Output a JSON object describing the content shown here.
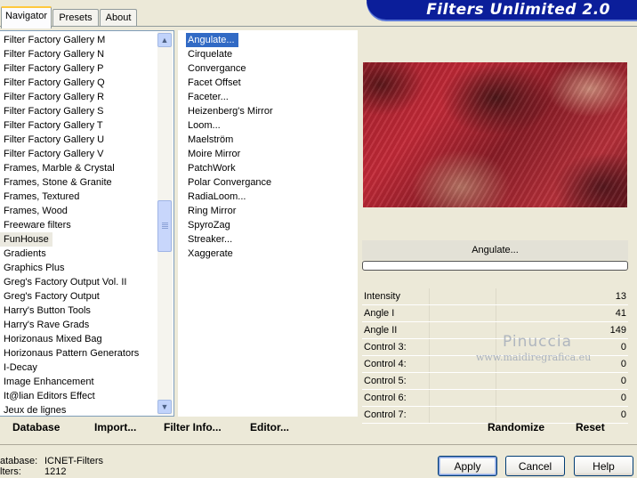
{
  "tabs": [
    "Navigator",
    "Presets",
    "About"
  ],
  "header_title": "Filters Unlimited 2.0",
  "categories": [
    "Filter Factory Gallery M",
    "Filter Factory Gallery N",
    "Filter Factory Gallery P",
    "Filter Factory Gallery Q",
    "Filter Factory Gallery R",
    "Filter Factory Gallery S",
    "Filter Factory Gallery T",
    "Filter Factory Gallery U",
    "Filter Factory Gallery V",
    "Frames, Marble & Crystal",
    "Frames, Stone & Granite",
    "Frames, Textured",
    "Frames, Wood",
    "Freeware filters",
    "FunHouse",
    "Gradients",
    "Graphics Plus",
    "Greg's Factory Output Vol. II",
    "Greg's Factory Output",
    "Harry's Button Tools",
    "Harry's Rave Grads",
    "Horizonaus Mixed Bag",
    "Horizonaus Pattern Generators",
    "I-Decay",
    "Image Enhancement",
    "It@lian Editors Effect",
    "Jeux de lignes"
  ],
  "selected_category": "FunHouse",
  "filters": [
    "Angulate...",
    "Cirquelate",
    "Convergance",
    "Facet Offset",
    "Faceter...",
    "Heizenberg's Mirror",
    "Loom...",
    "Maelström",
    "Moire Mirror",
    "PatchWork",
    "Polar Convergance",
    "RadiaLoom...",
    "Ring Mirror",
    "SpyroZag",
    "Streaker...",
    "Xaggerate"
  ],
  "selected_filter": "Angulate...",
  "filter_name": "Angulate...",
  "progress": 0,
  "controls": [
    {
      "label": "Intensity",
      "value": "13"
    },
    {
      "label": "Angle I",
      "value": "41"
    },
    {
      "label": "Angle II",
      "value": "149"
    },
    {
      "label": "Control 3:",
      "value": "0"
    },
    {
      "label": "Control 4:",
      "value": "0"
    },
    {
      "label": "Control 5:",
      "value": "0"
    },
    {
      "label": "Control 6:",
      "value": "0"
    },
    {
      "label": "Control 7:",
      "value": "0"
    }
  ],
  "bottom_links": {
    "database": "Database",
    "import": "Import...",
    "filter_info": "Filter Info...",
    "editor": "Editor...",
    "randomize": "Randomize",
    "reset": "Reset"
  },
  "status": {
    "database_label": "atabase:",
    "database_value": "ICNET-Filters",
    "filters_label": "lters:",
    "filters_value": "1212"
  },
  "buttons": {
    "apply": "Apply",
    "cancel": "Cancel",
    "help": "Help"
  },
  "watermark": {
    "name": "Pinuccia",
    "url": "www.maidiregrafica.eu"
  },
  "colors": {
    "selection": "#316ac5",
    "banner": "#0b1e9a",
    "background": "#ece9d8"
  }
}
